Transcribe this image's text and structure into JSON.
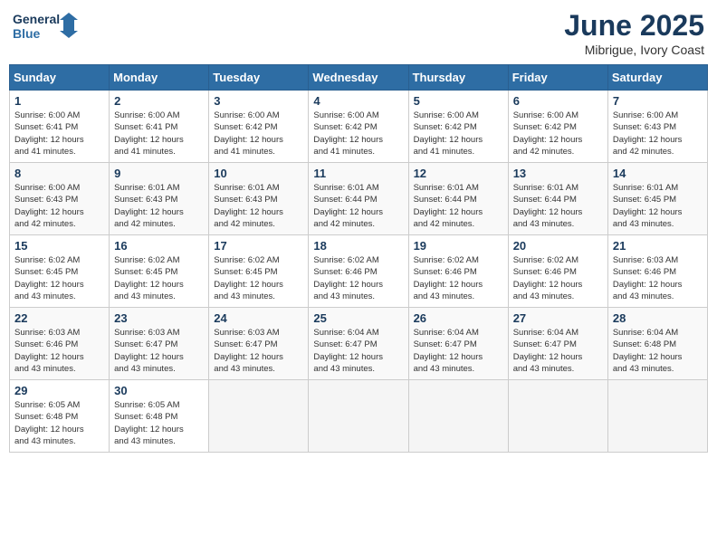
{
  "logo": {
    "line1": "General",
    "line2": "Blue"
  },
  "title": "June 2025",
  "location": "Mibrigue, Ivory Coast",
  "days_header": [
    "Sunday",
    "Monday",
    "Tuesday",
    "Wednesday",
    "Thursday",
    "Friday",
    "Saturday"
  ],
  "weeks": [
    [
      {
        "day": "1",
        "info": "Sunrise: 6:00 AM\nSunset: 6:41 PM\nDaylight: 12 hours\nand 41 minutes."
      },
      {
        "day": "2",
        "info": "Sunrise: 6:00 AM\nSunset: 6:41 PM\nDaylight: 12 hours\nand 41 minutes."
      },
      {
        "day": "3",
        "info": "Sunrise: 6:00 AM\nSunset: 6:42 PM\nDaylight: 12 hours\nand 41 minutes."
      },
      {
        "day": "4",
        "info": "Sunrise: 6:00 AM\nSunset: 6:42 PM\nDaylight: 12 hours\nand 41 minutes."
      },
      {
        "day": "5",
        "info": "Sunrise: 6:00 AM\nSunset: 6:42 PM\nDaylight: 12 hours\nand 41 minutes."
      },
      {
        "day": "6",
        "info": "Sunrise: 6:00 AM\nSunset: 6:42 PM\nDaylight: 12 hours\nand 42 minutes."
      },
      {
        "day": "7",
        "info": "Sunrise: 6:00 AM\nSunset: 6:43 PM\nDaylight: 12 hours\nand 42 minutes."
      }
    ],
    [
      {
        "day": "8",
        "info": "Sunrise: 6:00 AM\nSunset: 6:43 PM\nDaylight: 12 hours\nand 42 minutes."
      },
      {
        "day": "9",
        "info": "Sunrise: 6:01 AM\nSunset: 6:43 PM\nDaylight: 12 hours\nand 42 minutes."
      },
      {
        "day": "10",
        "info": "Sunrise: 6:01 AM\nSunset: 6:43 PM\nDaylight: 12 hours\nand 42 minutes."
      },
      {
        "day": "11",
        "info": "Sunrise: 6:01 AM\nSunset: 6:44 PM\nDaylight: 12 hours\nand 42 minutes."
      },
      {
        "day": "12",
        "info": "Sunrise: 6:01 AM\nSunset: 6:44 PM\nDaylight: 12 hours\nand 42 minutes."
      },
      {
        "day": "13",
        "info": "Sunrise: 6:01 AM\nSunset: 6:44 PM\nDaylight: 12 hours\nand 43 minutes."
      },
      {
        "day": "14",
        "info": "Sunrise: 6:01 AM\nSunset: 6:45 PM\nDaylight: 12 hours\nand 43 minutes."
      }
    ],
    [
      {
        "day": "15",
        "info": "Sunrise: 6:02 AM\nSunset: 6:45 PM\nDaylight: 12 hours\nand 43 minutes."
      },
      {
        "day": "16",
        "info": "Sunrise: 6:02 AM\nSunset: 6:45 PM\nDaylight: 12 hours\nand 43 minutes."
      },
      {
        "day": "17",
        "info": "Sunrise: 6:02 AM\nSunset: 6:45 PM\nDaylight: 12 hours\nand 43 minutes."
      },
      {
        "day": "18",
        "info": "Sunrise: 6:02 AM\nSunset: 6:46 PM\nDaylight: 12 hours\nand 43 minutes."
      },
      {
        "day": "19",
        "info": "Sunrise: 6:02 AM\nSunset: 6:46 PM\nDaylight: 12 hours\nand 43 minutes."
      },
      {
        "day": "20",
        "info": "Sunrise: 6:02 AM\nSunset: 6:46 PM\nDaylight: 12 hours\nand 43 minutes."
      },
      {
        "day": "21",
        "info": "Sunrise: 6:03 AM\nSunset: 6:46 PM\nDaylight: 12 hours\nand 43 minutes."
      }
    ],
    [
      {
        "day": "22",
        "info": "Sunrise: 6:03 AM\nSunset: 6:46 PM\nDaylight: 12 hours\nand 43 minutes."
      },
      {
        "day": "23",
        "info": "Sunrise: 6:03 AM\nSunset: 6:47 PM\nDaylight: 12 hours\nand 43 minutes."
      },
      {
        "day": "24",
        "info": "Sunrise: 6:03 AM\nSunset: 6:47 PM\nDaylight: 12 hours\nand 43 minutes."
      },
      {
        "day": "25",
        "info": "Sunrise: 6:04 AM\nSunset: 6:47 PM\nDaylight: 12 hours\nand 43 minutes."
      },
      {
        "day": "26",
        "info": "Sunrise: 6:04 AM\nSunset: 6:47 PM\nDaylight: 12 hours\nand 43 minutes."
      },
      {
        "day": "27",
        "info": "Sunrise: 6:04 AM\nSunset: 6:47 PM\nDaylight: 12 hours\nand 43 minutes."
      },
      {
        "day": "28",
        "info": "Sunrise: 6:04 AM\nSunset: 6:48 PM\nDaylight: 12 hours\nand 43 minutes."
      }
    ],
    [
      {
        "day": "29",
        "info": "Sunrise: 6:05 AM\nSunset: 6:48 PM\nDaylight: 12 hours\nand 43 minutes."
      },
      {
        "day": "30",
        "info": "Sunrise: 6:05 AM\nSunset: 6:48 PM\nDaylight: 12 hours\nand 43 minutes."
      },
      {
        "day": "",
        "info": ""
      },
      {
        "day": "",
        "info": ""
      },
      {
        "day": "",
        "info": ""
      },
      {
        "day": "",
        "info": ""
      },
      {
        "day": "",
        "info": ""
      }
    ]
  ]
}
